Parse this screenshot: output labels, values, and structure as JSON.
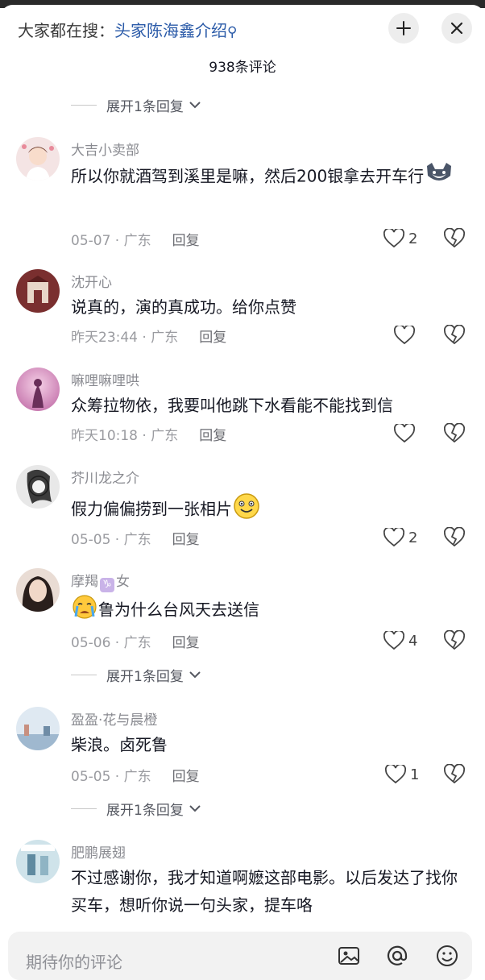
{
  "header": {
    "search_prefix": "大家都在搜：",
    "search_keyword": "头家陈海鑫介绍",
    "comment_count": "938条评论"
  },
  "expanders": {
    "label": "展开1条回复"
  },
  "comments": [
    {
      "username": "大吉小卖部",
      "text": "所以你就酒驾到溪里是嘛，然后200银拿去开车行",
      "time": "05-07 · 广东",
      "reply": "回复",
      "likes": "2"
    },
    {
      "username": "沈开心",
      "text": "说真的，演的真成功。给你点赞",
      "time": "昨天23:44 · 广东",
      "reply": "回复",
      "likes": ""
    },
    {
      "username": "嘛哩嘛哩哄",
      "text": "众筹拉物依，我要叫他跳下水看能不能找到信",
      "time": "昨天10:18 · 广东",
      "reply": "回复",
      "likes": ""
    },
    {
      "username": "芥川龙之介",
      "text": "假力偏偏捞到一张相片",
      "time": "05-05 · 广东",
      "reply": "回复",
      "likes": "2"
    },
    {
      "username": "摩羯",
      "username_suffix": "女",
      "text": "鲁为什么台风天去送信",
      "time": "05-06 · 广东",
      "reply": "回复",
      "likes": "4"
    },
    {
      "username": "盈盈·花与晨橙",
      "text": "柴浪。卤死鲁",
      "time": "05-05 · 广东",
      "reply": "回复",
      "likes": "1"
    },
    {
      "username": "肥鹏展翅",
      "text": "不过感谢你，我才知道啊嬷这部电影。以后发达了找你买车，想听你说一句头家，提车咯"
    }
  ],
  "input": {
    "placeholder": "期待你的评论"
  },
  "colors": {
    "keyword": "#2a5aa8",
    "text": "#161823",
    "muted": "#9a9ba0"
  }
}
